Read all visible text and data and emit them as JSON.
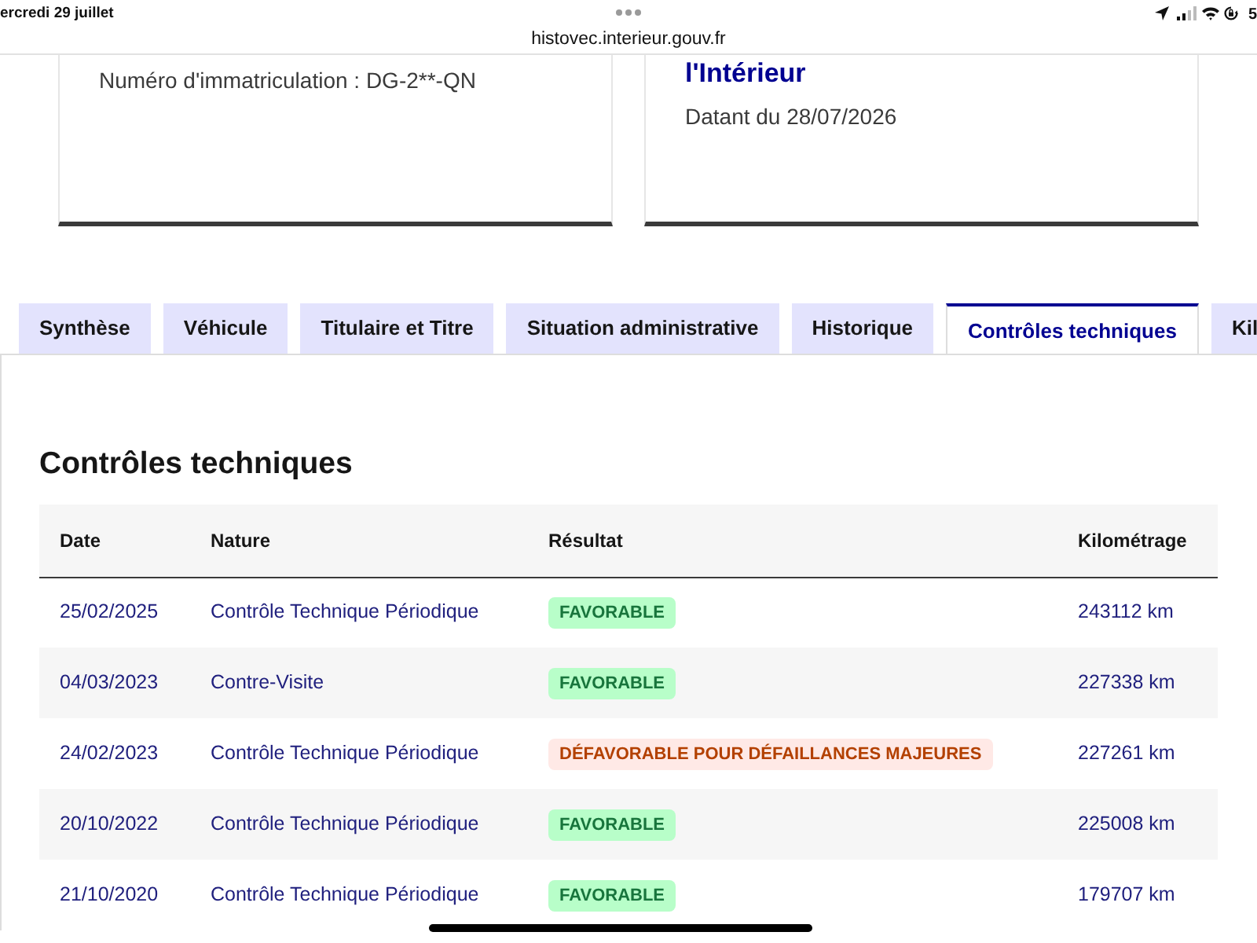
{
  "status_bar": {
    "date": "ercredi 29 juillet",
    "url": "histovec.interieur.gouv.fr",
    "battery": "5"
  },
  "cards": [
    {
      "lines": [
        {
          "kind": "text",
          "text": "Numéro d'immatriculation : DG-2**-QN"
        }
      ]
    },
    {
      "lines": [
        {
          "kind": "title",
          "text": "l'Intérieur"
        },
        {
          "kind": "text",
          "text": "Datant du 28/07/2026"
        }
      ]
    }
  ],
  "tabs": [
    {
      "label": "Synthèse",
      "selected": false
    },
    {
      "label": "Véhicule",
      "selected": false
    },
    {
      "label": "Titulaire et Titre",
      "selected": false
    },
    {
      "label": "Situation administrative",
      "selected": false
    },
    {
      "label": "Historique",
      "selected": false
    },
    {
      "label": "Contrôles techniques",
      "selected": true
    },
    {
      "label": "Kil",
      "selected": false
    }
  ],
  "section": {
    "title": "Contrôles techniques",
    "table": {
      "columns": [
        "Date",
        "Nature",
        "Résultat",
        "Kilométrage"
      ],
      "rows": [
        {
          "date": "25/02/2025",
          "nature": "Contrôle Technique Périodique",
          "result": {
            "kind": "favorable",
            "text": "FAVORABLE"
          },
          "mileage": "243112 km"
        },
        {
          "date": "04/03/2023",
          "nature": "Contre-Visite",
          "result": {
            "kind": "favorable",
            "text": "FAVORABLE"
          },
          "mileage": "227338 km"
        },
        {
          "date": "24/02/2023",
          "nature": "Contrôle Technique Périodique",
          "result": {
            "kind": "unfavorable",
            "text": "DÉFAVORABLE POUR DÉFAILLANCES MAJEURES"
          },
          "mileage": "227261 km"
        },
        {
          "date": "20/10/2022",
          "nature": "Contrôle Technique Périodique",
          "result": {
            "kind": "favorable",
            "text": "FAVORABLE"
          },
          "mileage": "225008 km"
        },
        {
          "date": "21/10/2020",
          "nature": "Contrôle Technique Périodique",
          "result": {
            "kind": "favorable",
            "text": "FAVORABLE"
          },
          "mileage": "179707 km"
        }
      ]
    }
  }
}
